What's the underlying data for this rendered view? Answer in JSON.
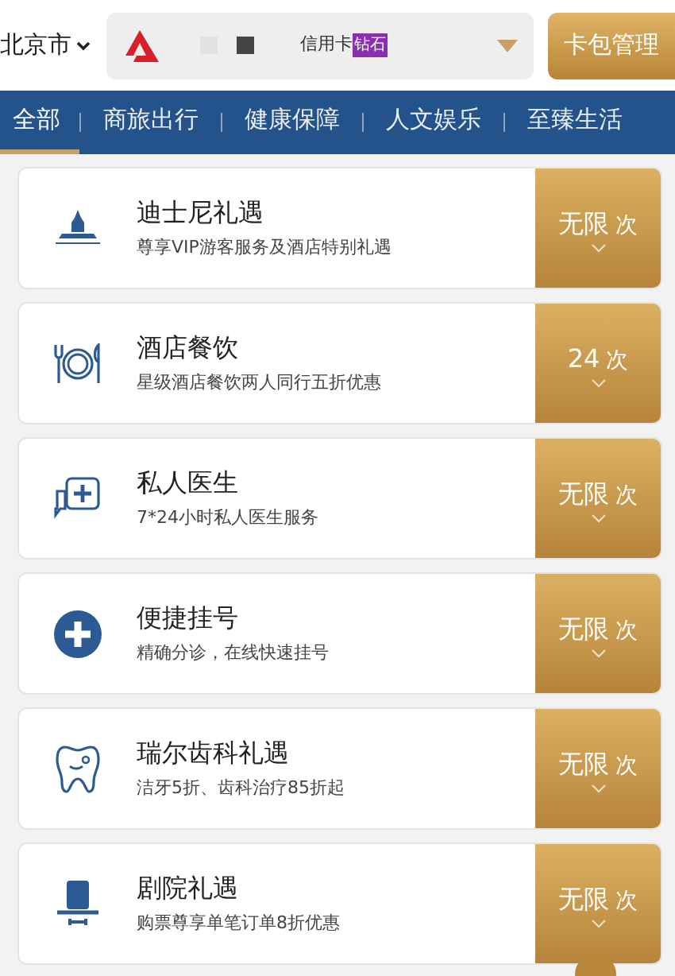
{
  "header": {
    "city": "北京市",
    "card_selector": {
      "card_type": "信用卡",
      "badge": "钻石"
    },
    "manage_button": "卡包管理"
  },
  "tabs": [
    {
      "label": "全部",
      "selected": true
    },
    {
      "label": "商旅出行",
      "selected": false
    },
    {
      "label": "健康保障",
      "selected": false
    },
    {
      "label": "人文娱乐",
      "selected": false
    },
    {
      "label": "至臻生活",
      "selected": false
    }
  ],
  "benefits": [
    {
      "kind": "castle",
      "title": "迪士尼礼遇",
      "subtitle": "尊享VIP游客服务及酒店特别礼遇",
      "count": "无限",
      "unit": "次"
    },
    {
      "kind": "dining",
      "title": "酒店餐饮",
      "subtitle": "星级酒店餐饮两人同行五折优惠",
      "count": "24",
      "unit": "次"
    },
    {
      "kind": "doctor",
      "title": "私人医生",
      "subtitle": "7*24小时私人医生服务",
      "count": "无限",
      "unit": "次"
    },
    {
      "kind": "cross",
      "title": "便捷挂号",
      "subtitle": "精确分诊，在线快速挂号",
      "count": "无限",
      "unit": "次"
    },
    {
      "kind": "tooth",
      "title": "瑞尔齿科礼遇",
      "subtitle": "洁牙5折、齿科治疗85折起",
      "count": "无限",
      "unit": "次"
    },
    {
      "kind": "hat",
      "title": "剧院礼遇",
      "subtitle": "购票尊享单笔订单8折优惠",
      "count": "无限",
      "unit": "次"
    }
  ]
}
